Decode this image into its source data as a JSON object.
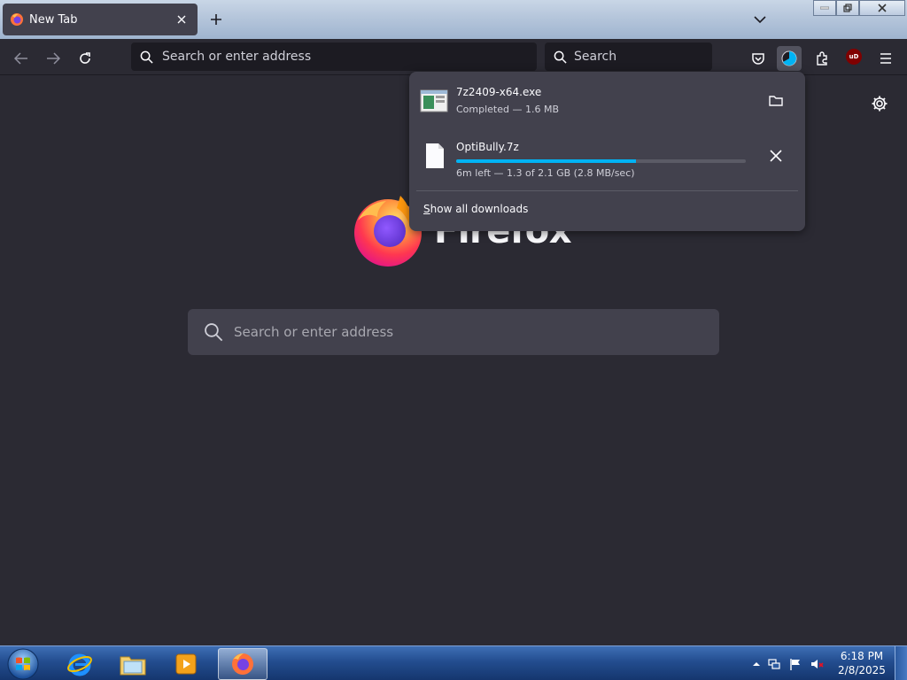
{
  "tab": {
    "title": "New Tab"
  },
  "navbar": {
    "url_placeholder": "Search or enter address",
    "search_placeholder": "Search"
  },
  "newtab": {
    "wordmark": "Firefox",
    "search_placeholder": "Search or enter address"
  },
  "downloads": {
    "items": [
      {
        "name": "7z2409-x64.exe",
        "status": "Completed — 1.6 MB",
        "action_icon": "folder-icon"
      },
      {
        "name": "OptiBully.7z",
        "status": "6m left — 1.3 of 2.1 GB (2.8 MB/sec)",
        "progress": 0.62,
        "action_icon": "cancel-icon"
      }
    ],
    "show_all_prefix": "S",
    "show_all_rest": "how all downloads"
  },
  "extensions": {
    "ublock_label": "uD"
  },
  "taskbar": {
    "apps": [
      "internet-explorer",
      "windows-explorer",
      "media-player",
      "firefox"
    ],
    "active_app": "firefox",
    "clock_time": "6:18 PM",
    "clock_date": "2/8/2025"
  },
  "colors": {
    "background": "#2b2a33",
    "panel": "#42414d",
    "accent": "#00b3f4",
    "text": "#fbfbfe"
  }
}
